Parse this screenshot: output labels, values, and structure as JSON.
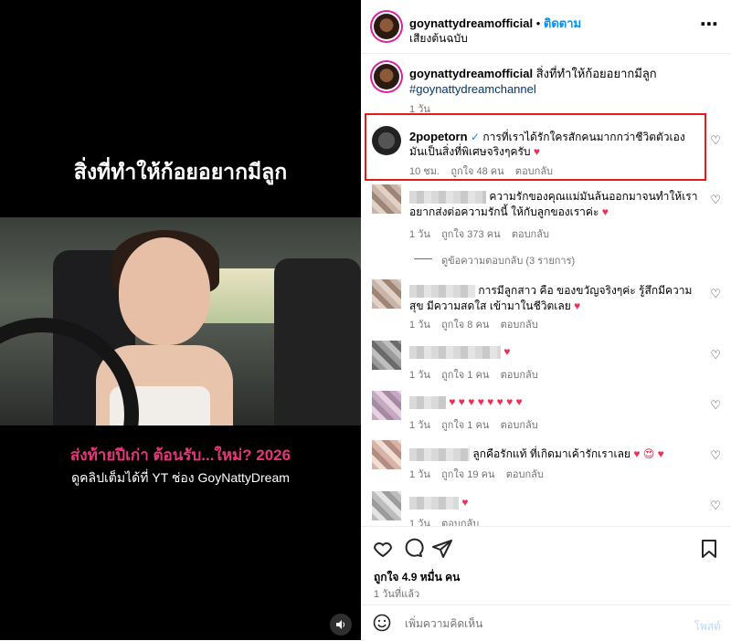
{
  "media": {
    "title": "สิ่งที่ทำให้ก้อยอยากมีลูก",
    "subtitle_pink": "ส่งท้ายปีเก่า ต้อนรับ...ใหม่? 2026",
    "subtitle_white": "ดูคลิปเต็มได้ที่ YT ช่อง GoyNattyDream"
  },
  "header": {
    "username": "goynattydreamofficial",
    "separator": "•",
    "follow": "ติดตาม",
    "audio": "เสียงต้นฉบับ",
    "more": "⋯"
  },
  "caption": {
    "username": "goynattydreamofficial",
    "text": "สิ่งที่ทำให้ก้อยอยากมีลูก",
    "hashtag": "#goynattydreamchannel",
    "time": "1 วัน"
  },
  "comments": [
    {
      "username": "2popetorn",
      "verified": "✓",
      "text": "การที่เราได้รักใครสักคนมากกว่าชีวิตตัวเอง มันเป็นสิ่งที่พิเศษจริงๆครับ",
      "emoji": "♥",
      "time": "10 ชม.",
      "likes": "ถูกใจ 48 คน",
      "reply": "ตอบกลับ"
    },
    {
      "text": "ความรักของคุณแม่มันล้นออกมาจนทำให้เราอยากส่งต่อความรักนี้ ให้กับลูกของเราค่ะ",
      "emoji": "♥",
      "time": "1 วัน",
      "likes": "ถูกใจ 373 คน",
      "reply": "ตอบกลับ",
      "view_replies": "ดูข้อความตอบกลับ (3 รายการ)"
    },
    {
      "text": "การมีลูกสาว คือ ของขวัญจริงๆค่ะ รู้สึกมีความสุข มีความสดใส เข้ามาในชีวิตเลย",
      "emoji": "♥",
      "time": "1 วัน",
      "likes": "ถูกใจ 8 คน",
      "reply": "ตอบกลับ"
    },
    {
      "text": "",
      "emoji": "♥",
      "time": "1 วัน",
      "likes": "ถูกใจ 1 คน",
      "reply": "ตอบกลับ"
    },
    {
      "text": "",
      "emoji": "♥ ♥ ♥ ♥ ♥ ♥ ♥ ♥",
      "time": "1 วัน",
      "likes": "ถูกใจ 1 คน",
      "reply": "ตอบกลับ"
    },
    {
      "text": "ลูกคือรักแท้ ที่เกิดมาเค้ารักเราเลย",
      "emoji": "♥ 😍 ♥",
      "time": "1 วัน",
      "likes": "ถูกใจ 19 คน",
      "reply": "ตอบกลับ"
    },
    {
      "text": "",
      "emoji": "♥",
      "time": "1 วัน",
      "reply": "ตอบกลับ"
    }
  ],
  "actions": {
    "likes": "ถูกใจ 4.9 หมื่น คน",
    "time": "1 วันที่แล้ว"
  },
  "composer": {
    "placeholder": "เพิ่มความคิดเห็น",
    "post": "โพสต์"
  },
  "colors": {
    "accent": "#0095f6",
    "heart": "#ed2f56",
    "highlight": "#e11b1b"
  }
}
